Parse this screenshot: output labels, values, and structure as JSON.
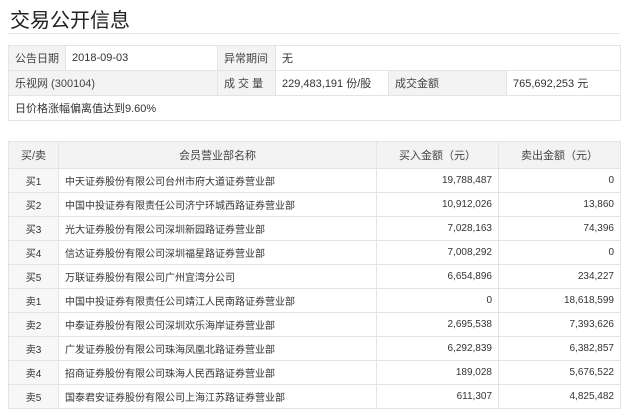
{
  "page": {
    "title": "交易公开信息"
  },
  "info": {
    "date_label": "公告日期",
    "date_value": "2018-09-03",
    "abnormal_label": "异常期间",
    "abnormal_value": "无",
    "stock_name": "乐视网 (300104)",
    "volume_label": "成 交 量",
    "volume_value": "229,483,191 份/股",
    "amount_label": "成交金额",
    "amount_value": "765,692,253 元",
    "note": "日价格涨幅偏离值达到9.60%"
  },
  "table": {
    "headers": [
      "买/卖",
      "会员营业部名称",
      "买入金额（元）",
      "卖出金额（元）"
    ],
    "rows": [
      {
        "side": "买1",
        "broker": "中天证券股份有限公司台州市府大道证券营业部",
        "buy": "19,788,487",
        "sell": "0"
      },
      {
        "side": "买2",
        "broker": "中国中投证券有限责任公司济宁环城西路证券营业部",
        "buy": "10,912,026",
        "sell": "13,860"
      },
      {
        "side": "买3",
        "broker": "光大证券股份有限公司深圳新园路证券营业部",
        "buy": "7,028,163",
        "sell": "74,396"
      },
      {
        "side": "买4",
        "broker": "信达证券股份有限公司深圳福星路证券营业部",
        "buy": "7,008,292",
        "sell": "0"
      },
      {
        "side": "买5",
        "broker": "万联证券股份有限公司广州宜湾分公司",
        "buy": "6,654,896",
        "sell": "234,227"
      },
      {
        "side": "卖1",
        "broker": "中国中投证券有限责任公司靖江人民南路证券营业部",
        "buy": "0",
        "sell": "18,618,599"
      },
      {
        "side": "卖2",
        "broker": "中泰证券股份有限公司深圳欢乐海岸证券营业部",
        "buy": "2,695,538",
        "sell": "7,393,626"
      },
      {
        "side": "卖3",
        "broker": "广发证券股份有限公司珠海凤凰北路证券营业部",
        "buy": "6,292,839",
        "sell": "6,382,857"
      },
      {
        "side": "卖4",
        "broker": "招商证券股份有限公司珠海人民西路证券营业部",
        "buy": "189,028",
        "sell": "5,676,522"
      },
      {
        "side": "卖5",
        "broker": "国泰君安证券股份有限公司上海江苏路证券营业部",
        "buy": "611,307",
        "sell": "4,825,482"
      }
    ]
  },
  "colors": {
    "header_bg": "#f3f3f3",
    "border": "#e4e4e4",
    "text": "#333333"
  }
}
